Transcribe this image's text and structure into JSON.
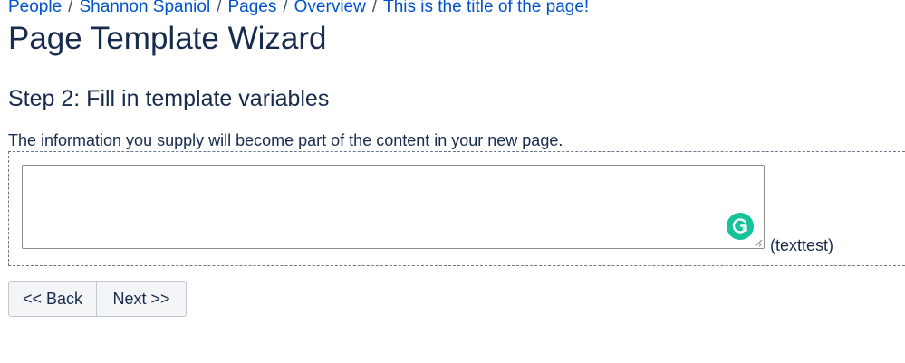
{
  "breadcrumb": {
    "items": [
      {
        "label": "People"
      },
      {
        "label": "Shannon Spaniol"
      },
      {
        "label": "Pages"
      },
      {
        "label": "Overview"
      },
      {
        "label": "This is the title of the page!"
      }
    ],
    "separator": "/"
  },
  "page": {
    "title": "Page Template Wizard",
    "step_heading": "Step 2: Fill in template variables",
    "info_text": "The information you supply will become part of the content in your new page."
  },
  "variables": [
    {
      "value": "",
      "label": "(texttest)"
    }
  ],
  "buttons": {
    "back_label": "<< Back",
    "next_label": "Next >>"
  },
  "colors": {
    "link": "#0052cc",
    "text": "#172b4d",
    "grammarly": "#15c39a"
  },
  "icons": {
    "grammarly": "grammarly-icon",
    "resize": "resize-handle-icon"
  }
}
